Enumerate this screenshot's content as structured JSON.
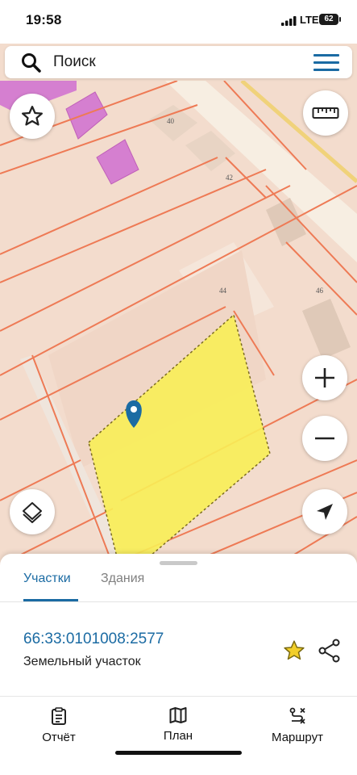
{
  "status_bar": {
    "time": "19:58",
    "network": "LTE",
    "battery": "62"
  },
  "search": {
    "placeholder": "Поиск"
  },
  "map": {
    "house_numbers": [
      "40",
      "42",
      "44",
      "46"
    ],
    "colors": {
      "parcel_highlight": "#f8ee57",
      "boundary": "#ee7a55",
      "restricted_zone": "#d57fd0",
      "background": "#f3dccd"
    }
  },
  "map_controls": [
    "favorites-star",
    "ruler",
    "zoom-in",
    "zoom-out",
    "layers",
    "my-location"
  ],
  "sheet": {
    "tabs": [
      {
        "label": "Участки",
        "active": true
      },
      {
        "label": "Здания",
        "active": false
      }
    ],
    "parcel": {
      "cadastral_number": "66:33:0101008:2577",
      "type": "Земельный участок"
    }
  },
  "bottom_nav": [
    {
      "label": "Отчёт",
      "icon": "report-icon"
    },
    {
      "label": "План",
      "icon": "map-plan-icon"
    },
    {
      "label": "Маршрут",
      "icon": "route-icon"
    }
  ],
  "accent_color": "#1b6ba3"
}
